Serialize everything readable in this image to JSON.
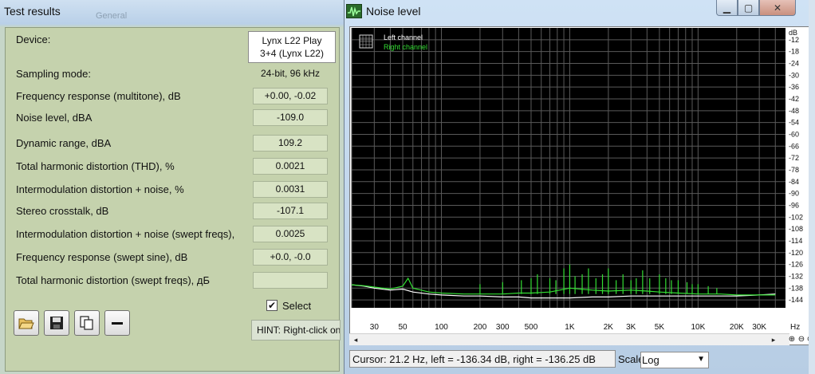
{
  "results_window": {
    "title": "Test results",
    "tab_ghost": "General",
    "device_label": "Device:",
    "device_value_line1": "Lynx L22 Play",
    "device_value_line2": "3+4 (Lynx L22)",
    "rows": [
      {
        "label": "Sampling mode:",
        "value": "24-bit, 96 kHz"
      },
      {
        "label": "Frequency response (multitone), dB",
        "value": "+0.00, -0.02"
      },
      {
        "label": "Noise level, dBA",
        "value": "-109.0"
      },
      {
        "label": "Dynamic range, dBA",
        "value": "109.2"
      },
      {
        "label": "Total harmonic distortion (THD), %",
        "value": "0.0021"
      },
      {
        "label": "Intermodulation distortion + noise, %",
        "value": "0.0031"
      },
      {
        "label": "Stereo crosstalk, dB",
        "value": "-107.1"
      },
      {
        "label": "Intermodulation distortion + noise (swept freqs),",
        "value": "0.0025"
      },
      {
        "label": "Frequency response (swept sine), dB",
        "value": "+0.0, -0.0"
      },
      {
        "label": "Total harmonic distortion (swept freqs), дБ",
        "value": ""
      }
    ],
    "toolbar": {
      "open_icon": "folder-open-icon",
      "save_icon": "save-icon",
      "copy_icon": "copy-icon",
      "remove_icon": "minus-icon"
    },
    "select_checked": "✔",
    "select_label": "Select",
    "hint": "HINT: Right-click on"
  },
  "noise_window": {
    "title": "Noise level",
    "title_icon": "waveform-icon",
    "controls": {
      "minimize": "▁",
      "maximize": "▢",
      "close": "✕"
    },
    "legend_icon": "grid-icon",
    "cursor_readout": "Cursor:  21.2 Hz,  left = -136.34 dB,  right = -136.25 dB",
    "scale_label": "Scale",
    "scale_value": "Log",
    "scale_options_visible": [
      "Log"
    ],
    "zoom_icons": [
      "zoom-in-icon",
      "zoom-out-icon",
      "zoom-reset-icon"
    ],
    "scroll_left": "◂",
    "scroll_right": "▸"
  },
  "chart_data": {
    "type": "line",
    "title": "",
    "xlabel": "Hz",
    "ylabel": "dB",
    "x_scale": "log",
    "xlim": [
      20,
      48000
    ],
    "ylim": [
      -148,
      -6
    ],
    "x_tick_labels": [
      "30",
      "50",
      "100",
      "200",
      "300",
      "500",
      "1K",
      "2K",
      "3K",
      "5K",
      "10K",
      "20K",
      "30K"
    ],
    "x_tick_values": [
      30,
      50,
      100,
      200,
      300,
      500,
      1000,
      2000,
      3000,
      5000,
      10000,
      20000,
      30000
    ],
    "y_tick_labels": [
      "-12",
      "-18",
      "-24",
      "-30",
      "-36",
      "-42",
      "-48",
      "-54",
      "-60",
      "-66",
      "-72",
      "-78",
      "-84",
      "-90",
      "-96",
      "-102",
      "-108",
      "-114",
      "-120",
      "-126",
      "-132",
      "-138",
      "-144"
    ],
    "y_tick_values": [
      -12,
      -18,
      -24,
      -30,
      -36,
      -42,
      -48,
      -54,
      -60,
      -66,
      -72,
      -78,
      -84,
      -90,
      -96,
      -102,
      -108,
      -114,
      -120,
      -126,
      -132,
      -138,
      -144
    ],
    "grid": true,
    "legend_position": "top-left",
    "background": "#000000",
    "series": [
      {
        "name": "Left channel",
        "color": "#ffffff",
        "x": [
          20,
          25,
          30,
          40,
          50,
          60,
          80,
          100,
          150,
          200,
          300,
          400,
          500,
          700,
          1000,
          1500,
          2000,
          3000,
          4000,
          5000,
          7000,
          10000,
          15000,
          20000,
          30000,
          40000
        ],
        "y": [
          -136.3,
          -137,
          -138,
          -139,
          -138.5,
          -140,
          -141,
          -141.5,
          -142,
          -142,
          -142.5,
          -142.5,
          -143,
          -143,
          -143,
          -142.5,
          -142.5,
          -142,
          -142,
          -142,
          -142,
          -142,
          -142,
          -142,
          -141.5,
          -141
        ]
      },
      {
        "name": "Right channel",
        "color": "#33dd33",
        "x": [
          20,
          25,
          30,
          40,
          50,
          55,
          60,
          80,
          100,
          150,
          200,
          300,
          400,
          500,
          700,
          1000,
          1500,
          2000,
          3000,
          4000,
          5000,
          7000,
          10000,
          15000,
          20000,
          30000,
          40000
        ],
        "y": [
          -136.3,
          -136.8,
          -137.5,
          -138.5,
          -137,
          -133,
          -138,
          -140,
          -140.5,
          -141,
          -141,
          -141,
          -140.5,
          -140.5,
          -140,
          -138,
          -139,
          -139.5,
          -139,
          -139.5,
          -140,
          -140.5,
          -141,
          -141,
          -141.5,
          -141.5,
          -141.5
        ]
      }
    ],
    "right_channel_spikes": {
      "x": [
        200,
        300,
        420,
        500,
        560,
        700,
        780,
        900,
        1000,
        1100,
        1250,
        1400,
        1600,
        1800,
        2000,
        2300,
        2600,
        3000,
        3300,
        3700,
        4200,
        5000,
        5600,
        6200,
        7000,
        8200,
        9000,
        10000,
        12000,
        14000
      ],
      "y": [
        -136,
        -135,
        -134,
        -133,
        -131,
        -133,
        -134,
        -128,
        -126,
        -132,
        -131,
        -128,
        -133,
        -131,
        -128,
        -134,
        -131,
        -134,
        -133,
        -129,
        -133,
        -131,
        -133,
        -134,
        -134,
        -135,
        -136,
        -136,
        -137,
        -138
      ]
    }
  }
}
